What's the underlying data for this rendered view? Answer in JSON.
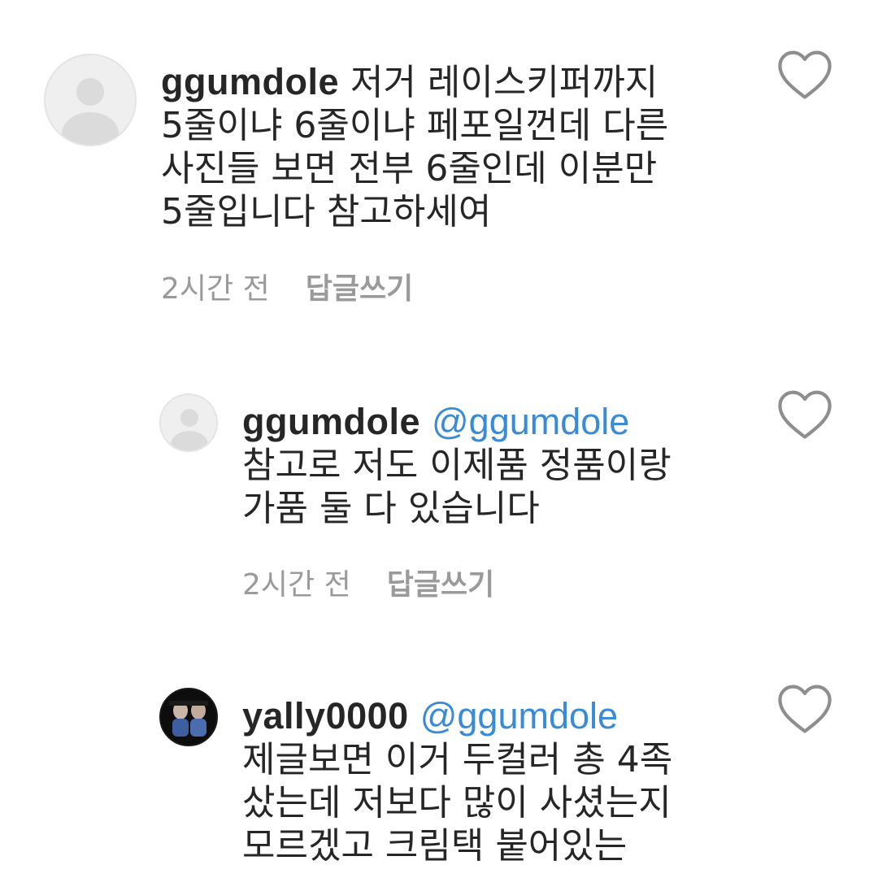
{
  "comments": [
    {
      "username": "ggumdole",
      "mention": "",
      "text": " 저거 레이스키퍼까지\n5줄이냐 6줄이냐 페포일껀데 다른\n사진들 보면 전부 6줄인데 이분만\n5줄입니다 참고하세여",
      "time": "2시간 전",
      "reply_label": "답글쓰기",
      "avatar": "default-avatar"
    },
    {
      "username": "ggumdole",
      "mention": "@ggumdole",
      "text": "참고로 저도 이제품 정품이랑\n가품 둘 다 있습니다",
      "time": "2시간 전",
      "reply_label": "답글쓰기",
      "avatar": "default-avatar"
    },
    {
      "username": "yally0000",
      "mention": "@ggumdole",
      "text": "제글보면 이거 두컬러 총 4족\n샀는데 저보다 많이 사셨는지\n모르겠고 크림택 붙어있는",
      "time": "",
      "reply_label": "",
      "avatar": "photo-avatar"
    }
  ],
  "colors": {
    "mention": "#3a8bd6",
    "meta": "#9a9a9a",
    "text": "#262626",
    "heart_stroke": "#8e8e8e"
  },
  "icons": {
    "like": "heart-outline-icon"
  }
}
